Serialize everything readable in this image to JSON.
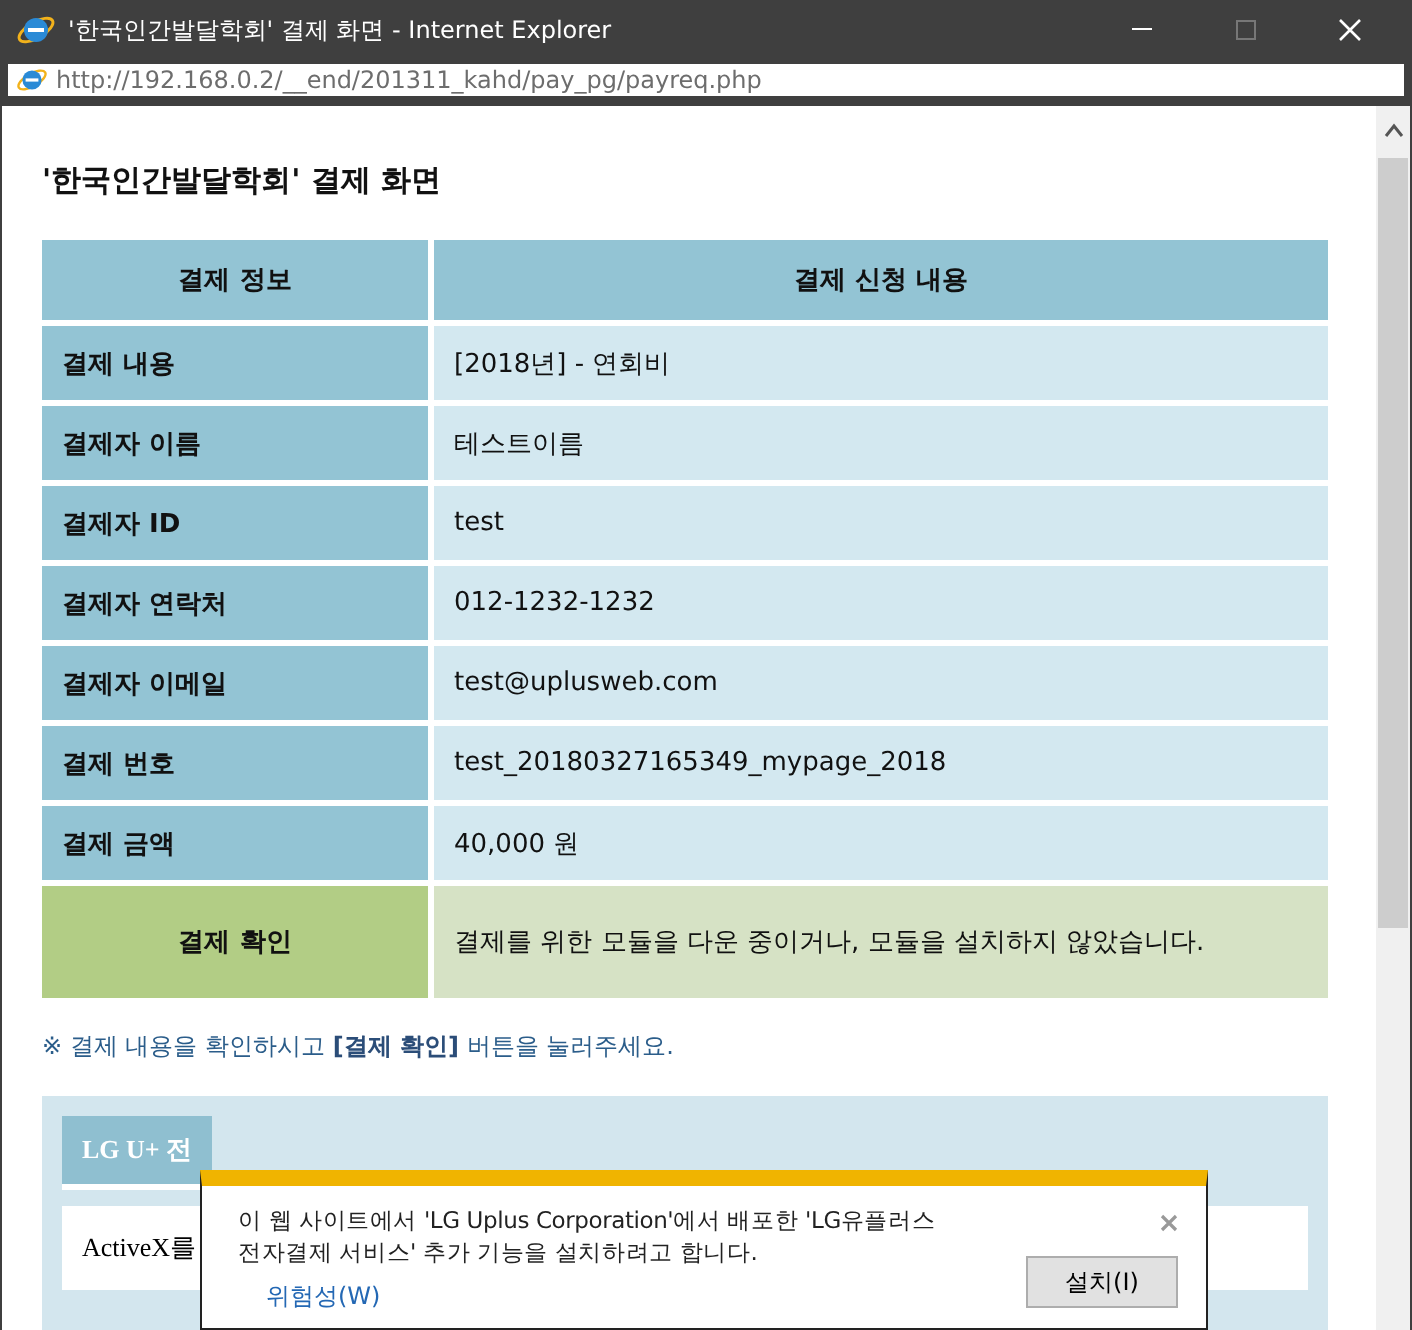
{
  "window": {
    "title": "'한국인간발달학회' 결제 화면 - Internet Explorer"
  },
  "address_bar": {
    "url": "http://192.168.0.2/__end/201311_kahd/pay_pg/payreq.php"
  },
  "page": {
    "heading": "'한국인간발달학회' 결제 화면",
    "table": {
      "columns": [
        "결제 정보",
        "결제 신청 내용"
      ],
      "rows": [
        {
          "kind": "info",
          "label": "결제 내용",
          "value": "[2018년] - 연회비"
        },
        {
          "kind": "info",
          "label": "결제자 이름",
          "value": "테스트이름"
        },
        {
          "kind": "info",
          "label": "결제자 ID",
          "value": "test"
        },
        {
          "kind": "info",
          "label": "결제자 연락처",
          "value": "012-1232-1232"
        },
        {
          "kind": "info",
          "label": "결제자 이메일",
          "value": "test@uplusweb.com"
        },
        {
          "kind": "info",
          "label": "결제 번호",
          "value": "test_20180327165349_mypage_2018"
        },
        {
          "kind": "info",
          "label": "결제 금액",
          "value": "40,000 원"
        },
        {
          "kind": "confirm",
          "label": "결제 확인",
          "value": "결제를 위한 모듈을 다운 중이거나, 모듈을 설치하지 않았습니다."
        }
      ]
    },
    "note": "※ 결제 내용을 확인하시고 **[결제 확인]** 버튼을 눌러주세요.",
    "panel": {
      "title": "LG U+ 전",
      "line": "ActiveX를"
    }
  },
  "notification": {
    "message": "이 웹 사이트에서 'LG Uplus Corporation'에서 배포한 'LG유플러스 전자결제 서비스' 추가 기능을 설치하려고 합니다.",
    "link": "위험성(W)",
    "button": "설치(I)"
  }
}
